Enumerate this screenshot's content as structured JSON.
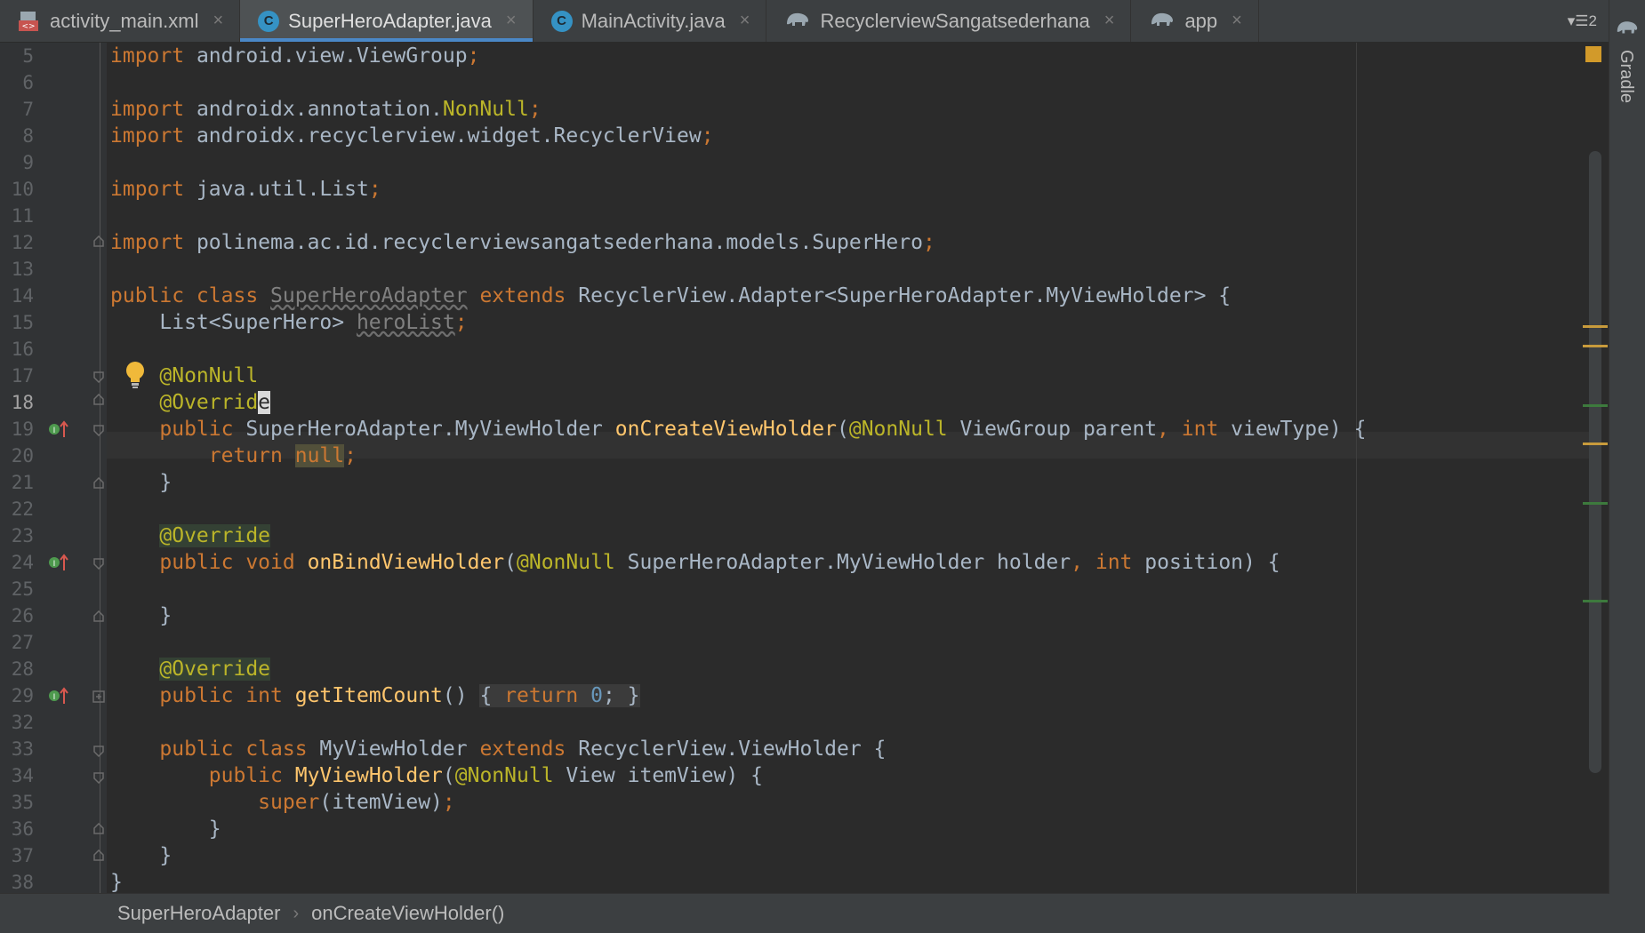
{
  "tabs": [
    {
      "label": "activity_main.xml",
      "icon": "xml-file-icon",
      "active": false
    },
    {
      "label": "SuperHeroAdapter.java",
      "icon": "java-class-icon",
      "active": true
    },
    {
      "label": "MainActivity.java",
      "icon": "java-class-icon",
      "active": false
    },
    {
      "label": "RecyclerviewSangatsederhana",
      "icon": "gradle-elephant-icon",
      "active": false
    },
    {
      "label": "app",
      "icon": "gradle-elephant-icon",
      "active": false
    }
  ],
  "tab_menu": {
    "count": "2"
  },
  "close_glyph": "×",
  "right_strip": {
    "label": "Gradle"
  },
  "line_numbers": [
    "5",
    "6",
    "7",
    "8",
    "9",
    "10",
    "11",
    "12",
    "13",
    "14",
    "15",
    "16",
    "17",
    "18",
    "19",
    "20",
    "21",
    "22",
    "23",
    "24",
    "25",
    "26",
    "27",
    "28",
    "29",
    "32",
    "33",
    "34",
    "35",
    "36",
    "37",
    "38"
  ],
  "current_line": "18",
  "breadcrumb": {
    "items": [
      "SuperHeroAdapter",
      "onCreateViewHolder()"
    ],
    "separator": "›"
  },
  "colors": {
    "background": "#2b2b2b",
    "keyword": "#cc7832",
    "annotation": "#bbb529",
    "method": "#ffc66d",
    "number": "#6897bb",
    "text": "#a9b7c6",
    "tab_underline": "#4a88c7"
  },
  "code": {
    "l5": [
      "import",
      " android.view.ViewGroup",
      ";"
    ],
    "l7": [
      "import",
      " androidx.annotation.",
      "NonNull",
      ";"
    ],
    "l8": [
      "import",
      " androidx.recyclerview.widget.RecyclerView",
      ";"
    ],
    "l10": [
      "import",
      " java.util.List",
      ";"
    ],
    "l12": [
      "import",
      " polinema.ac.id.recyclerviewsangatsederhana.models.SuperHero",
      ";"
    ],
    "l14": [
      "public class",
      "SuperHeroAdapter",
      "extends",
      " RecyclerView.Adapter<SuperHeroAdapter.MyViewHolder> {"
    ],
    "l15": [
      "    List<SuperHero> ",
      "heroList",
      ";"
    ],
    "l17": [
      "    ",
      "@NonNull"
    ],
    "l18": [
      "    ",
      "@Overrid",
      "e"
    ],
    "l19": [
      "    ",
      "public",
      " SuperHeroAdapter.MyViewHolder ",
      "onCreateViewHolder",
      "(",
      "@NonNull",
      " ViewGroup parent",
      ",",
      "int",
      " viewType) {"
    ],
    "l20": [
      "        ",
      "return",
      "null",
      ";"
    ],
    "l21": [
      "    }"
    ],
    "l23": [
      "    ",
      "@Override"
    ],
    "l24": [
      "    ",
      "public void",
      "onBindViewHolder",
      "(",
      "@NonNull",
      " SuperHeroAdapter.MyViewHolder holder",
      ",",
      "int",
      " position) {"
    ],
    "l26": [
      "    }"
    ],
    "l28": [
      "    ",
      "@Override"
    ],
    "l29": [
      "    ",
      "public int",
      "getItemCount",
      "()",
      "{ ",
      "return",
      "0",
      "; }"
    ],
    "l33": [
      "    ",
      "public class",
      " MyViewHolder ",
      "extends",
      " RecyclerView.ViewHolder {"
    ],
    "l34": [
      "        ",
      "public",
      "MyViewHolder",
      "(",
      "@NonNull",
      " View itemView) {"
    ],
    "l35": [
      "            ",
      "super",
      "(itemView)",
      ";"
    ],
    "l36": [
      "        }"
    ],
    "l37": [
      "    }"
    ],
    "l38": [
      "}"
    ]
  }
}
